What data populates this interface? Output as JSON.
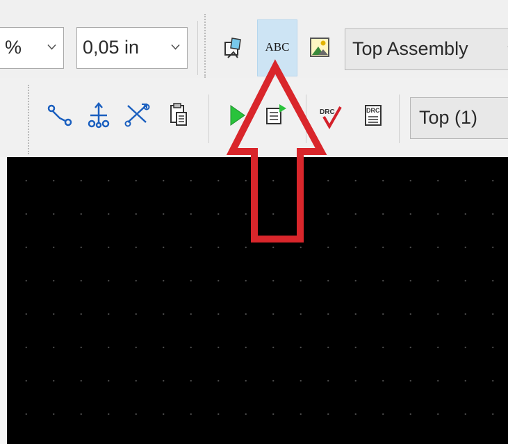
{
  "toolbar_row1": {
    "zoom_combo": {
      "value": "%"
    },
    "grid_combo": {
      "value": "0,05 in"
    },
    "layer_set_combo": {
      "value": "Top Assembly"
    },
    "buttons": [
      {
        "name": "place-component",
        "icon": "component-place-icon"
      },
      {
        "name": "place-text",
        "icon": "abc-text-icon",
        "label": "ABC",
        "state": "hover"
      },
      {
        "name": "place-picture",
        "icon": "picture-icon"
      }
    ]
  },
  "toolbar_row2": {
    "layer_combo": {
      "value": "Top (1)"
    },
    "buttons": [
      {
        "name": "route-track",
        "icon": "route-icon"
      },
      {
        "name": "fanout",
        "icon": "fanout-icon"
      },
      {
        "name": "swap",
        "icon": "swap-icon"
      },
      {
        "name": "netlist",
        "icon": "clipboard-icon"
      },
      {
        "name": "run",
        "icon": "play-icon"
      },
      {
        "name": "report",
        "icon": "report-icon"
      },
      {
        "name": "drc-check",
        "icon": "drc-check-icon",
        "label": "DRC"
      },
      {
        "name": "drc-report",
        "icon": "drc-report-icon",
        "label": "DRC"
      }
    ]
  },
  "annotation": {
    "type": "arrow",
    "pointing_to": "place-text",
    "color": "#d9262b"
  },
  "canvas": {
    "background": "#000000",
    "grid_dot_color": "#4a4a4a"
  },
  "colors": {
    "toolbar_bg": "#f0f0f0",
    "active_button_bg": "#cde4f4"
  }
}
